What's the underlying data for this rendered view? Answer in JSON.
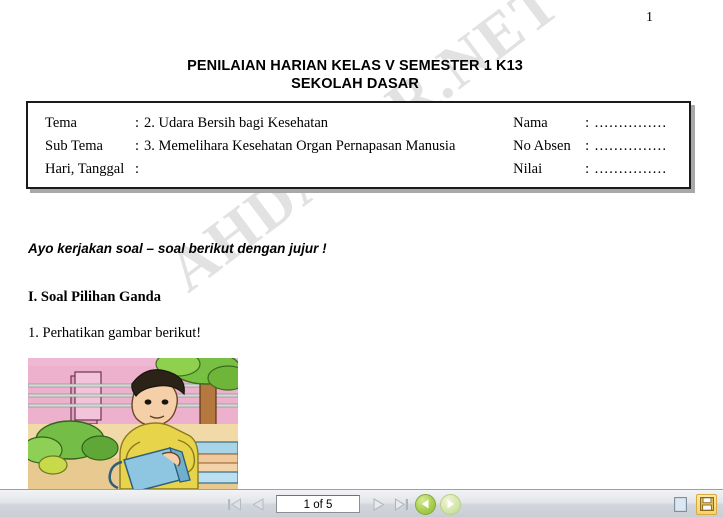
{
  "viewer": {
    "watermark": "AHDASAR.NET",
    "page_label": "1"
  },
  "document": {
    "title_line1": "PENILAIAN HARIAN KELAS V SEMESTER 1 K13",
    "title_line2": "SEKOLAH DASAR",
    "identity": {
      "left_rows": [
        {
          "label": "Tema",
          "sep": ":",
          "value": "2. Udara Bersih bagi Kesehatan"
        },
        {
          "label": "Sub Tema",
          "sep": ":",
          "value": "3. Memelihara Kesehatan Organ Pernapasan Manusia"
        },
        {
          "label": "Hari, Tanggal",
          "sep": ":",
          "value": ""
        }
      ],
      "right_rows": [
        {
          "label": "Nama",
          "sep": ":",
          "value": "……………"
        },
        {
          "label": "No Absen",
          "sep": ":",
          "value": "……………"
        },
        {
          "label": "Nilai",
          "sep": ":",
          "value": "……………"
        }
      ]
    },
    "instruction": "Ayo kerjakan soal – soal berikut dengan jujur !",
    "section_heading": "I. Soal Pilihan Ganda",
    "question_1": "1. Perhatikan gambar berikut!",
    "illustration_alt": "boy-watering-plants-illustration"
  },
  "toolbar": {
    "first_page_icon": "first-page-icon",
    "prev_page_icon": "previous-page-icon",
    "page_indicator": "1 of 5",
    "next_page_icon": "next-page-icon",
    "last_page_icon": "last-page-icon",
    "history_back_icon": "history-back-icon",
    "history_forward_icon": "history-forward-icon",
    "single_page_icon": "single-page-view-icon",
    "save_icon": "save-icon"
  },
  "colors": {
    "accent_green": "#a8cf4e",
    "highlight_yellow": "#f8d36a",
    "border_dark": "#1a1a1a",
    "toolbar_bg": "#e3e6ea"
  }
}
